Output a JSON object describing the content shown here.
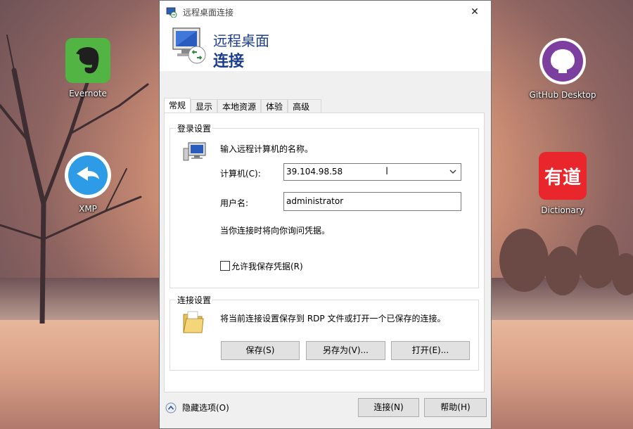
{
  "desktop": {
    "icons": [
      {
        "label": "Evernote",
        "icon": "evernote-icon"
      },
      {
        "label": "XMP",
        "icon": "xmp-icon"
      },
      {
        "label": "GitHub Desktop",
        "icon": "github-icon"
      },
      {
        "label": "Dictionary",
        "icon": "dictionary-icon"
      }
    ],
    "dictionary_glyph": "有道"
  },
  "window": {
    "title": "远程桌面连接",
    "close_glyph": "✕",
    "banner_line1": "远程桌面",
    "banner_line2": "连接",
    "tabs": [
      "常规",
      "显示",
      "本地资源",
      "体验",
      "高级"
    ],
    "active_tab": "常规",
    "login_group": {
      "legend": "登录设置",
      "prompt": "输入远程计算机的名称。",
      "computer_label": "计算机(C):",
      "computer_value": "39.104.98.58",
      "username_label": "用户名:",
      "username_value": "administrator",
      "info": "当你连接时将向你询问凭据。",
      "save_credentials_label": "允许我保存凭据(R)",
      "save_credentials_checked": false
    },
    "connection_group": {
      "legend": "连接设置",
      "description": "将当前连接设置保存到 RDP 文件或打开一个已保存的连接。",
      "save_button": "保存(S)",
      "save_as_button": "另存为(V)...",
      "open_button": "打开(E)..."
    },
    "footer": {
      "hide_options": "隐藏选项(O)",
      "connect_button": "连接(N)",
      "help_button": "帮助(H)"
    }
  }
}
